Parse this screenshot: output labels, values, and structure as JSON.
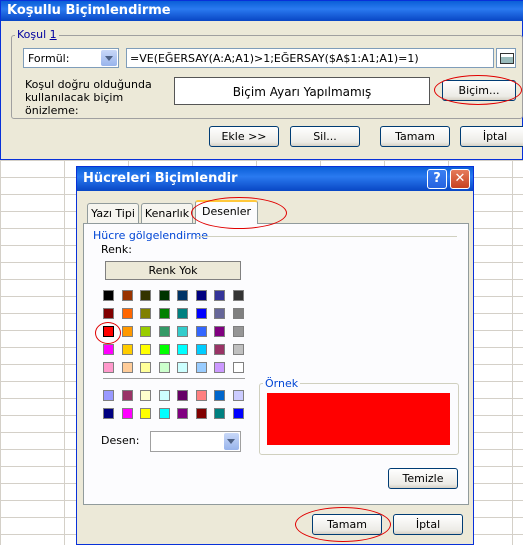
{
  "conditional_dialog": {
    "title": "Koşullu Biçimlendirme",
    "condition_label_prefix": "Koşul ",
    "condition_label_num": "1",
    "condition_type": "Formül:",
    "formula": "=VE(EĞERSAY(A:A;A1)>1;EĞERSAY($A$1:A1;A1)=1)",
    "preview_label": "Koşul doğru olduğunda kullanılacak biçim önizleme:",
    "preview_text": "Biçim Ayarı Yapılmamış",
    "format_button": "Biçim...",
    "add_button": "Ekle >>",
    "delete_button": "Sil...",
    "ok_button": "Tamam",
    "cancel_button": "İptal"
  },
  "format_cells_dialog": {
    "title": "Hücreleri Biçimlendir",
    "help_glyph": "?",
    "close_glyph": "✕",
    "tabs": [
      {
        "label": "Yazı Tipi"
      },
      {
        "label": "Kenarlık"
      },
      {
        "label": "Desenler"
      }
    ],
    "active_tab": "Desenler",
    "section_label": "Hücre gölgelendirme",
    "color_label": "Renk:",
    "no_color_button": "Renk Yok",
    "pattern_label": "Desen:",
    "sample_label": "Örnek",
    "sample_color": "#ff0000",
    "selected_color": "#ff0000",
    "clear_button": "Temizle",
    "ok_button": "Tamam",
    "cancel_button": "İptal",
    "palette_main": [
      [
        "#000000",
        "#993300",
        "#333300",
        "#003300",
        "#003366",
        "#000080",
        "#333399",
        "#333333"
      ],
      [
        "#800000",
        "#ff6600",
        "#808000",
        "#008000",
        "#008080",
        "#0000ff",
        "#666699",
        "#808080"
      ],
      [
        "#ff0000",
        "#ff9900",
        "#99cc00",
        "#339966",
        "#33cccc",
        "#3366ff",
        "#800080",
        "#969696"
      ],
      [
        "#ff00ff",
        "#ffcc00",
        "#ffff00",
        "#00ff00",
        "#00ffff",
        "#00ccff",
        "#993366",
        "#c0c0c0"
      ],
      [
        "#ff99cc",
        "#ffcc99",
        "#ffff99",
        "#ccffcc",
        "#ccffff",
        "#99ccff",
        "#cc99ff",
        "#ffffff"
      ]
    ],
    "palette_chart": [
      [
        "#9999ff",
        "#993366",
        "#ffffcc",
        "#ccffff",
        "#660066",
        "#ff8080",
        "#0066cc",
        "#ccccff"
      ],
      [
        "#000080",
        "#ff00ff",
        "#ffff00",
        "#00ffff",
        "#800080",
        "#800000",
        "#008080",
        "#0000ff"
      ]
    ]
  },
  "colors": {
    "title_bar": "#0a5fd8",
    "dialog_bg": "#ece9d8",
    "annotation_red": "#e00000"
  }
}
